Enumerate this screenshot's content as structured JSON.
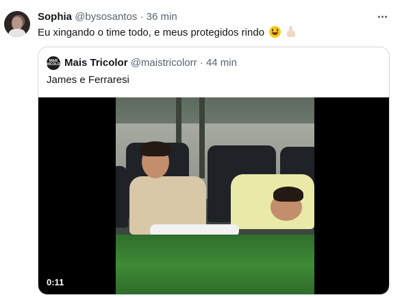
{
  "tweet": {
    "author_name": "Sophia",
    "handle": "@bysosantos",
    "separator": "·",
    "time": "36 min",
    "text": "Eu xingando o time todo, e meus protegidos rindo",
    "emojis": [
      "grinning-face-emoji",
      "thumbs-up-emoji"
    ]
  },
  "quoted": {
    "author_name": "Mais Tricolor",
    "handle": "@maistricolorr",
    "separator": "·",
    "time": "44 min",
    "avatar_text": "MAIS TRICOLOR",
    "text": "James e Ferraresi",
    "video": {
      "duration": "0:11"
    }
  },
  "colors": {
    "text_primary": "#0f1419",
    "text_muted": "#536471",
    "border": "#cfd9de"
  }
}
